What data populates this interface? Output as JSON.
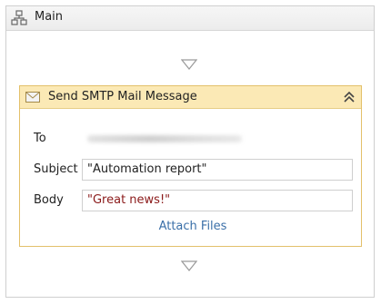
{
  "sequence": {
    "title": "Main",
    "icon": "sequence-icon"
  },
  "activity": {
    "title": "Send SMTP Mail Message",
    "icon": "envelope-icon",
    "collapse_icon": "double-chevron-up-icon",
    "fields": {
      "to": {
        "label": "To",
        "value": ""
      },
      "subject": {
        "label": "Subject",
        "value": "\"Automation report\""
      },
      "body": {
        "label": "Body",
        "value": "\"Great news!\""
      }
    },
    "attach_label": "Attach Files"
  },
  "colors": {
    "activity_border": "#e3c06a",
    "activity_header": "#fbe9b5",
    "link": "#3a6fa8",
    "string_literal": "#8b1a1a"
  }
}
